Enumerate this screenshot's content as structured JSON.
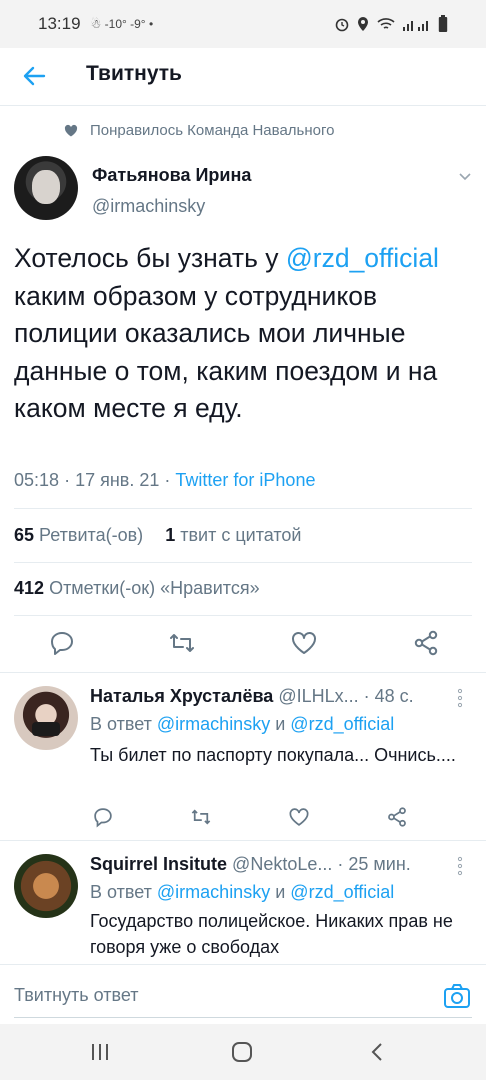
{
  "status_bar": {
    "time": "13:19",
    "temperature": "-10° -9°",
    "dot": "•"
  },
  "header": {
    "title": "Твитнуть",
    "back_icon": "arrow-left-icon"
  },
  "liked_by": {
    "text": "Понравилось Команда Навального",
    "icon": "heart-icon"
  },
  "tweet": {
    "author_name": "Фатьянова Ирина",
    "author_handle": "@irmachinsky",
    "text_part1": "Хотелось бы узнать у ",
    "mention": "@rzd_official",
    "text_part2": " каким образом у сотрудников полиции оказались мои личные данные о том, каким поездом и на каком месте я еду.",
    "time": "05:18",
    "date": "17 янв. 21",
    "separator": "·",
    "source": "Twitter for iPhone"
  },
  "stats": {
    "retweets_count": "65",
    "retweets_label": "Ретвита(-ов)",
    "quotes_count": "1",
    "quotes_label": "твит с цитатой",
    "likes_count": "412",
    "likes_label": "Отметки(-ок) «Нравится»"
  },
  "replies": [
    {
      "name": "Наталья Хрусталёва",
      "handle": "@ILHLx...",
      "time": "· 48 с.",
      "reply_to_prefix": "В ответ",
      "reply_to_1": "@irmachinsky",
      "reply_to_and": "и",
      "reply_to_2": "@rzd_official",
      "text": "Ты билет по паспорту покупала... Очнись...."
    },
    {
      "name": "Squirrel Insitute",
      "handle": "@NektoLe...",
      "time": "· 25 мин.",
      "reply_to_prefix": "В ответ",
      "reply_to_1": "@irmachinsky",
      "reply_to_and": "и",
      "reply_to_2": "@rzd_official",
      "text": "Государство полицейское. Никаких прав не говоря уже о свободах"
    }
  ],
  "reply_bar": {
    "placeholder": "Твитнуть ответ"
  },
  "colors": {
    "accent": "#1da1f2",
    "secondary_text": "#657786",
    "divider": "#e6ecf0"
  }
}
